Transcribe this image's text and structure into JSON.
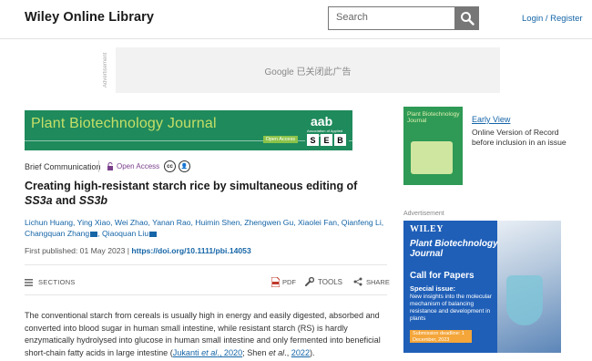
{
  "header": {
    "site_name": "Wiley Online Library",
    "search_placeholder": "Search",
    "login_label": "Login / Register"
  },
  "top_ad": {
    "label": "Advertisement",
    "text": "Google 已关闭此广告"
  },
  "journal_banner": {
    "title": "Plant Biotechnology Journal",
    "open_access": "Open Access",
    "aab_logo": "aab",
    "aab_sub": "Association of Applied Biologists",
    "seb_letters": [
      "S",
      "E",
      "B"
    ]
  },
  "article": {
    "type": "Brief Communication",
    "open_access_label": "Open Access",
    "license_icons": [
      "cc-icon",
      "by-icon"
    ],
    "title_part1": "Creating high-resistant starch rice by simultaneous editing of",
    "title_gene1": "SS3a",
    "title_and": " and ",
    "title_gene2": "SS3b",
    "authors_line1": "Lichun Huang, Ying Xiao, Wei Zhao, Yanan Rao, Huimin Shen, Zhengwen Gu, Xiaolei Fan, Qianfeng Li,",
    "author_changquan": "Changquan Zhang",
    "author_qiaoquan": "Qiaoquan Liu",
    "first_published_label": "First published: 01 May 2023",
    "separator": "|",
    "doi": "https://doi.org/10.1111/pbi.14053"
  },
  "toolbar": {
    "sections": "SECTIONS",
    "pdf": "PDF",
    "tools": "TOOLS",
    "share": "SHARE"
  },
  "abstract": {
    "text1": "The conventional starch from cereals is usually high in energy and easily digested, absorbed and converted into blood sugar in human small intestine, while resistant starch (RS) is hardly enzymatically hydrolysed into glucose in human small intestine and only fermented into beneficial short-chain fatty acids in large intestine (",
    "cite1_author": "Jukanti ",
    "cite1_etal": "et al",
    "cite1_sep": "., ",
    "cite1_year": "2020",
    "mid": "; Shen ",
    "cite2_etal": "et al",
    "cite2_sep": "., ",
    "cite2_year": "2022",
    "end": ")."
  },
  "sidebar": {
    "cover_title": "Plant Biotechnology Journal",
    "early_view": "Early View",
    "early_view_desc": "Online Version of Record before inclusion in an issue",
    "ad_label": "Advertisement",
    "ad": {
      "brand": "WILEY",
      "journal": "Plant Biotechnology Journal",
      "call": "Call for Papers",
      "special": "Special issue:",
      "desc": "New insights into the molecular mechanism of balancing resistance and development in plants",
      "deadline": "Submission deadline: 1 December, 2023"
    }
  },
  "colors": {
    "link": "#1565a7",
    "banner_green": "#1f8a5c",
    "banner_title": "#c6df67",
    "ad_blue": "#1f5fb8",
    "oa_purple": "#7b3f8c"
  }
}
